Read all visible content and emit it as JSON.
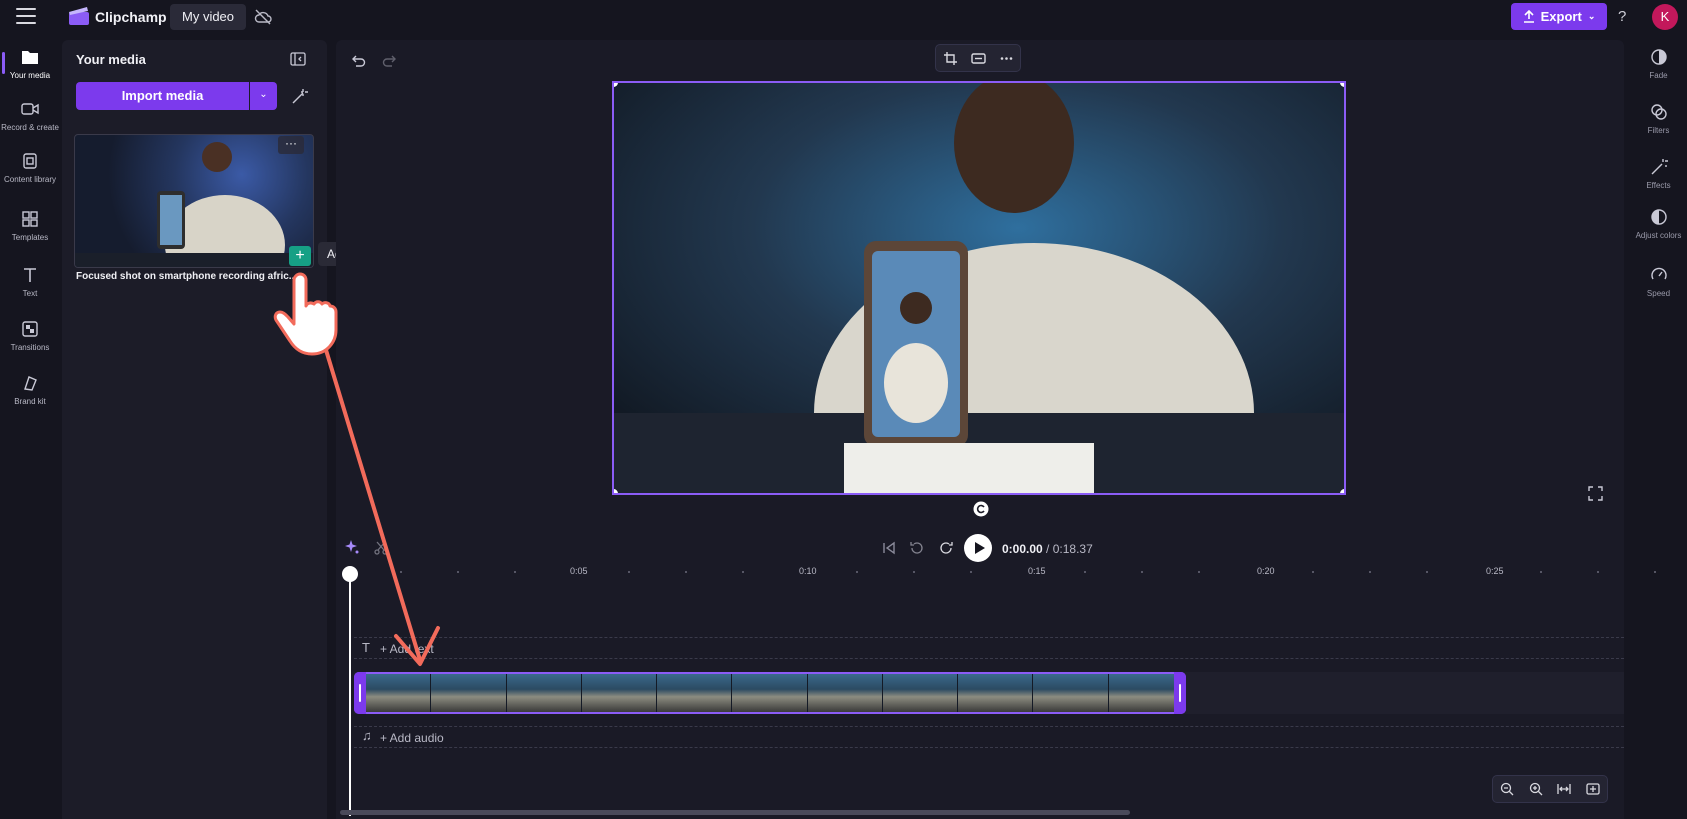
{
  "topbar": {
    "app_name": "Clipchamp",
    "project_tab": "My video",
    "export_label": "Export",
    "help": "?",
    "avatar_initial": "K"
  },
  "left_rail": [
    {
      "label": "Your media",
      "icon": "folder-icon"
    },
    {
      "label": "Record & create",
      "icon": "camera-icon"
    },
    {
      "label": "Content library",
      "icon": "library-icon"
    },
    {
      "label": "Templates",
      "icon": "templates-icon"
    },
    {
      "label": "Text",
      "icon": "text-icon"
    },
    {
      "label": "Transitions",
      "icon": "transitions-icon"
    },
    {
      "label": "Brand kit",
      "icon": "brand-kit-icon"
    }
  ],
  "media_panel": {
    "title": "Your media",
    "import_label": "Import media",
    "media_item": {
      "caption": "Focused shot on smartphone recording afric...",
      "more": "···"
    },
    "tooltip": "Add to timeline"
  },
  "playback": {
    "current_time": "0:00.00",
    "separator": " / ",
    "duration": "0:18.37"
  },
  "ruler": {
    "labels": [
      "0:05",
      "0:10",
      "0:15",
      "0:20",
      "0:25"
    ]
  },
  "tracks": {
    "add_text": "+ Add text",
    "add_audio": "+ Add audio"
  },
  "right_rail": [
    {
      "label": "Fade",
      "icon": "fade-icon"
    },
    {
      "label": "Filters",
      "icon": "filters-icon"
    },
    {
      "label": "Effects",
      "icon": "effects-icon"
    },
    {
      "label": "Adjust colors",
      "icon": "adjust-colors-icon"
    },
    {
      "label": "Speed",
      "icon": "speed-icon"
    }
  ],
  "colors": {
    "accent": "#7c3aed",
    "selection": "#8b5cf6",
    "add_button": "#16a085",
    "annotation_arrow": "#f26b5b"
  }
}
